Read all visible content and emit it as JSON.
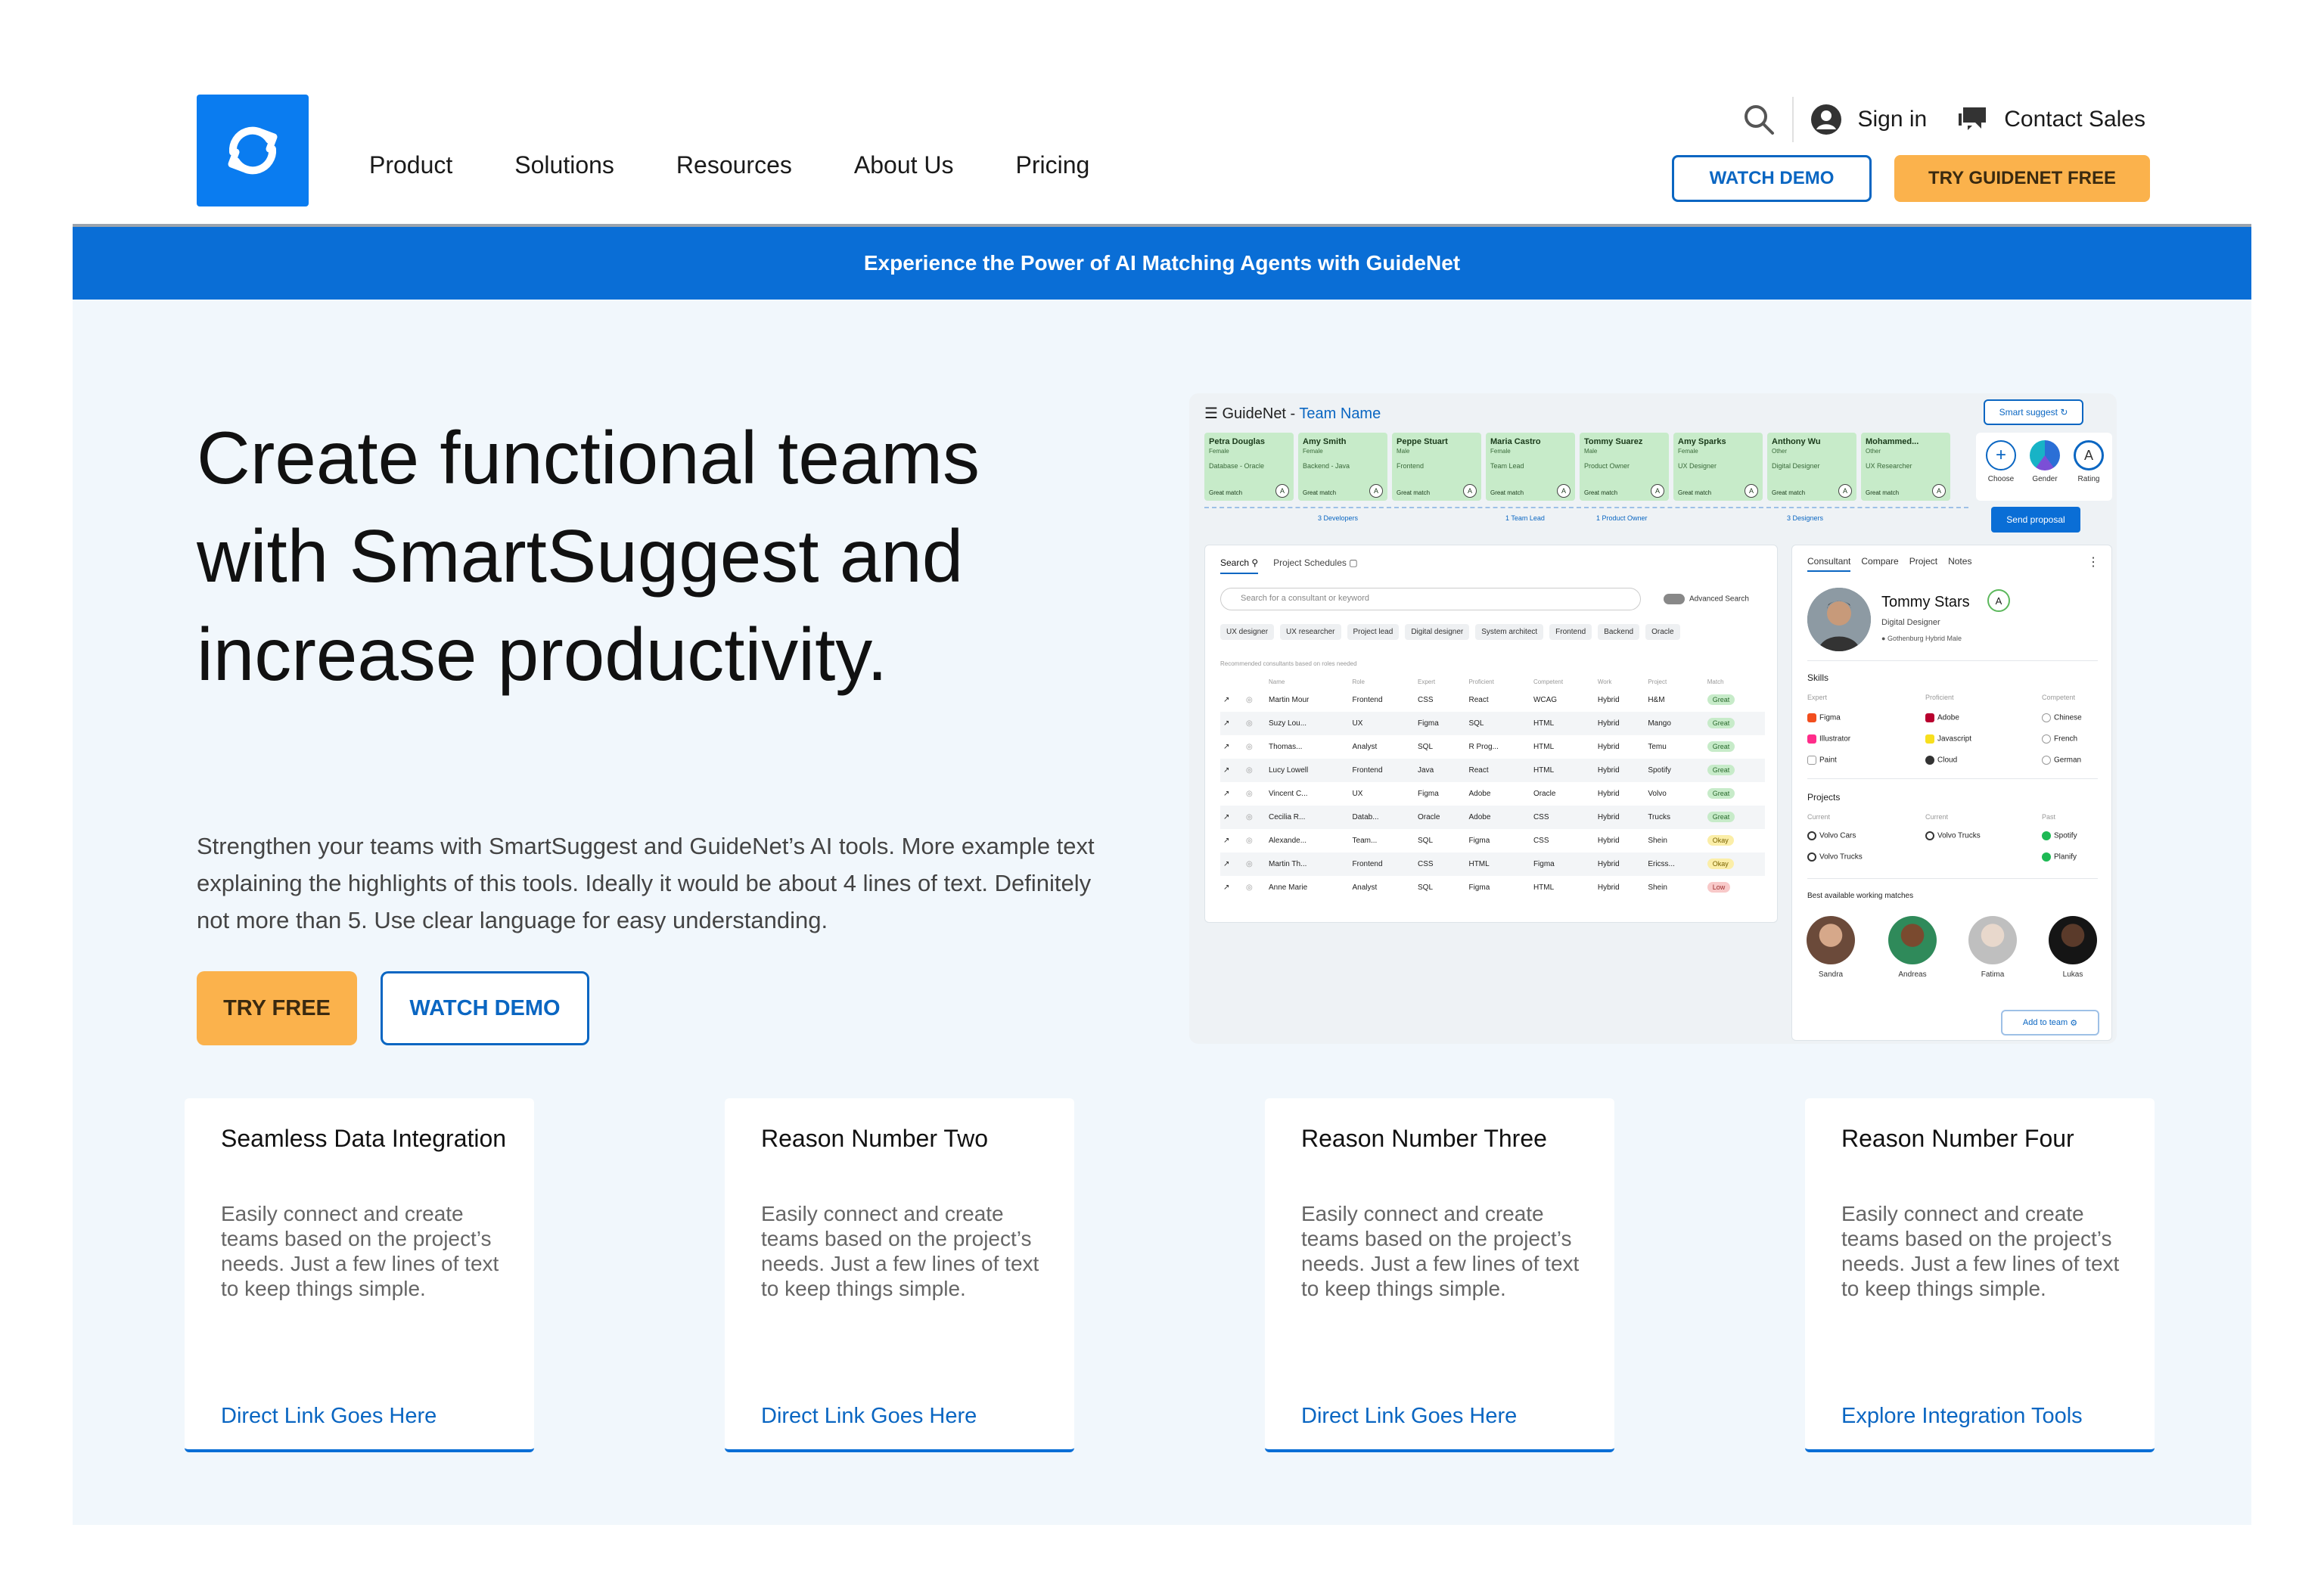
{
  "header": {
    "nav": [
      "Product",
      "Solutions",
      "Resources",
      "About Us",
      "Pricing"
    ],
    "sign_in": "Sign in",
    "contact_sales": "Contact Sales",
    "watch_demo": "WATCH DEMO",
    "try_free": "TRY GUIDENET FREE"
  },
  "banner": "Experience the Power of AI Matching Agents with GuideNet",
  "hero": {
    "title": "Create functional teams with SmartSuggest and increase productivity.",
    "lead": "Strengthen your teams with SmartSuggest and GuideNet’s AI tools. More example text explaining the highlights of this tools. Ideally it would be about 4 lines of text. Definitely not more than 5. Use clear language for easy understanding.",
    "try_free": "TRY FREE",
    "watch_demo": "WATCH DEMO"
  },
  "app": {
    "brand": "GuideNet - ",
    "team_name": "Team Name",
    "smart_suggest": "Smart suggest",
    "members": [
      {
        "name": "Petra Douglas",
        "gender": "Female",
        "role": "Database - Oracle",
        "match": "Great match",
        "score": "A"
      },
      {
        "name": "Amy Smith",
        "gender": "Female",
        "role": "Backend - Java",
        "match": "Great match",
        "score": "A"
      },
      {
        "name": "Peppe Stuart",
        "gender": "Male",
        "role": "Frontend",
        "match": "Great match",
        "score": "A"
      },
      {
        "name": "Maria Castro",
        "gender": "Female",
        "role": "Team Lead",
        "match": "Great match",
        "score": "A"
      },
      {
        "name": "Tommy Suarez",
        "gender": "Male",
        "role": "Product Owner",
        "match": "Great match",
        "score": "A"
      },
      {
        "name": "Amy Sparks",
        "gender": "Female",
        "role": "UX Designer",
        "match": "Great match",
        "score": "A"
      },
      {
        "name": "Anthony Wu",
        "gender": "Other",
        "role": "Digital Designer",
        "match": "Great match",
        "score": "A"
      },
      {
        "name": "Mohammed...",
        "gender": "Other",
        "role": "UX Researcher",
        "match": "Great match",
        "score": "A"
      }
    ],
    "team_counts": [
      "3 Developers",
      "1 Team Lead",
      "1 Product Owner",
      "3 Designers"
    ],
    "tools": [
      "Choose",
      "Gender",
      "Rating"
    ],
    "rating_letter": "A",
    "send_proposal": "Send proposal",
    "search_tabs": [
      "Search",
      "Project Schedules"
    ],
    "search_placeholder": "Search for a consultant or keyword",
    "advanced_search": "Advanced Search",
    "chips": [
      "UX designer",
      "UX researcher",
      "Project lead",
      "Digital designer",
      "System architect",
      "Frontend",
      "Backend",
      "Oracle"
    ],
    "rec_note": "Recommended consultants based on roles needed",
    "columns": [
      "Name",
      "Role",
      "Expert",
      "Proficient",
      "Competent",
      "Work",
      "Project",
      "Match"
    ],
    "rows": [
      [
        "Martin Mour",
        "Frontend",
        "CSS",
        "React",
        "WCAG",
        "Hybrid",
        "H&M",
        "Great"
      ],
      [
        "Suzy Lou...",
        "UX",
        "Figma",
        "SQL",
        "HTML",
        "Hybrid",
        "Mango",
        "Great"
      ],
      [
        "Thomas...",
        "Analyst",
        "SQL",
        "R Prog...",
        "HTML",
        "Hybrid",
        "Temu",
        "Great"
      ],
      [
        "Lucy Lowell",
        "Frontend",
        "Java",
        "React",
        "HTML",
        "Hybrid",
        "Spotify",
        "Great"
      ],
      [
        "Vincent C...",
        "UX",
        "Figma",
        "Adobe",
        "Oracle",
        "Hybrid",
        "Volvo",
        "Great"
      ],
      [
        "Cecilia R...",
        "Datab...",
        "Oracle",
        "Adobe",
        "CSS",
        "Hybrid",
        "Trucks",
        "Great"
      ],
      [
        "Alexande...",
        "Team...",
        "SQL",
        "Figma",
        "CSS",
        "Hybrid",
        "Shein",
        "Okay"
      ],
      [
        "Martin Th...",
        "Frontend",
        "CSS",
        "HTML",
        "Figma",
        "Hybrid",
        "Ericss...",
        "Okay"
      ],
      [
        "Anne Marie",
        "Analyst",
        "SQL",
        "Figma",
        "HTML",
        "Hybrid",
        "Shein",
        "Low"
      ]
    ],
    "profile": {
      "tabs": [
        "Consultant",
        "Compare",
        "Project",
        "Notes"
      ],
      "name": "Tommy Stars",
      "score": "A",
      "role": "Digital Designer",
      "meta": "Gothenburg   Hybrid   Male",
      "skills_title": "Skills",
      "skill_levels": [
        "Expert",
        "Proficient",
        "Competent"
      ],
      "expert": [
        "Figma",
        "Illustrator",
        "Paint"
      ],
      "proficient": [
        "Adobe",
        "Javascript",
        "Cloud"
      ],
      "competent": [
        "Chinese",
        "French",
        "German"
      ],
      "projects_title": "Projects",
      "project_levels": [
        "Current",
        "Current",
        "Past"
      ],
      "current1": [
        "Volvo Cars",
        "Volvo Trucks"
      ],
      "current2": [
        "Volvo Trucks"
      ],
      "past": [
        "Spotify",
        "Planify"
      ],
      "matches_title": "Best available working matches",
      "matches": [
        "Sandra",
        "Andreas",
        "Fatima",
        "Lukas"
      ],
      "add_to_team": "Add to team"
    }
  },
  "reasons": [
    {
      "title": "Seamless Data Integration",
      "desc": "Easily connect and create teams based on the project’s needs. Just a few lines of text to keep things simple.",
      "link": "Direct Link Goes Here"
    },
    {
      "title": "Reason Number Two",
      "desc": "Easily connect and create teams based on the project’s needs. Just a few lines of text to keep things simple.",
      "link": "Direct Link Goes Here"
    },
    {
      "title": "Reason Number Three",
      "desc": "Easily connect and create teams based on the project’s needs. Just a few lines of text to keep things simple.",
      "link": "Direct Link Goes Here"
    },
    {
      "title": "Reason Number Four",
      "desc": "Easily connect and create teams based on the project’s needs. Just a few lines of text to keep things simple.",
      "link": "Explore Integration Tools"
    }
  ],
  "colors": {
    "brand_blue": "#0a6ed6",
    "accent_orange": "#fbb24c",
    "hero_bg": "#f1f7fc",
    "match_great": "#c7ebc9"
  }
}
